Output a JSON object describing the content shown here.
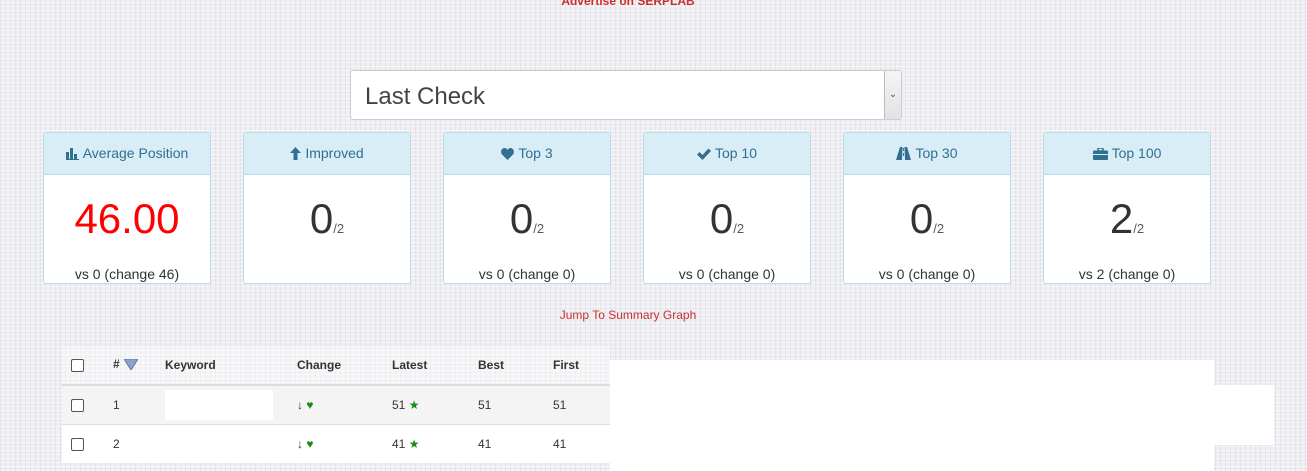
{
  "top_link": "Advertise on SERPLAB",
  "period_select": {
    "value": "Last Check"
  },
  "cards": [
    {
      "title": "Average Position",
      "icon": "bar-chart-icon",
      "value": "46.00",
      "of": "",
      "vs": "vs 0 (change 46)",
      "value_color": "#ff0000"
    },
    {
      "title": "Improved",
      "icon": "arrow-up-icon",
      "value": "0",
      "of": "/2",
      "vs": ""
    },
    {
      "title": "Top 3",
      "icon": "heart-icon",
      "value": "0",
      "of": "/2",
      "vs": "vs 0 (change 0)"
    },
    {
      "title": "Top 10",
      "icon": "checkmark-icon",
      "value": "0",
      "of": "/2",
      "vs": "vs 0 (change 0)"
    },
    {
      "title": "Top 30",
      "icon": "road-icon",
      "value": "0",
      "of": "/2",
      "vs": "vs 0 (change 0)"
    },
    {
      "title": "Top 100",
      "icon": "briefcase-icon",
      "value": "2",
      "of": "/2",
      "vs": "vs 2 (change 0)"
    }
  ],
  "jump_link": "Jump To Summary Graph",
  "table": {
    "headers": {
      "num": "#",
      "keyword": "Keyword",
      "change": "Change",
      "latest": "Latest",
      "best": "Best",
      "first": "First"
    },
    "rows": [
      {
        "num": "1",
        "keyword": "",
        "change_arrow": "↓",
        "latest": "51",
        "best": "51",
        "first": "51"
      },
      {
        "num": "2",
        "keyword": "",
        "change_arrow": "↓",
        "latest": "41",
        "best": "41",
        "first": "41"
      }
    ]
  }
}
